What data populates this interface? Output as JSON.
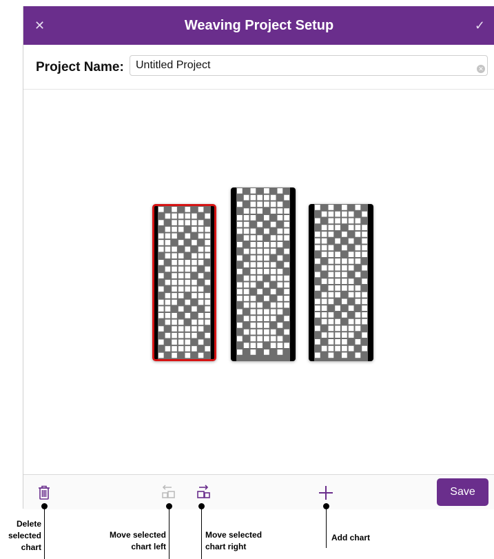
{
  "dialog": {
    "title": "Weaving Project Setup",
    "close_icon": "close-icon",
    "confirm_icon": "checkmark-icon",
    "accent_color": "#6a2e8c"
  },
  "project": {
    "label": "Project Name:",
    "value": "Untitled Project"
  },
  "charts": [
    {
      "name": "chart-1",
      "selected": true
    },
    {
      "name": "chart-2",
      "selected": false
    },
    {
      "name": "chart-3",
      "selected": false
    }
  ],
  "toolbar": {
    "delete_icon": "trash-icon",
    "move_left_icon": "move-left-icon",
    "move_right_icon": "move-right-icon",
    "add_icon": "plus-icon",
    "save_label": "Save"
  },
  "annotations": {
    "delete": [
      "Delete",
      "selected",
      "chart"
    ],
    "move_left": [
      "Move selected",
      "chart left"
    ],
    "move_right": [
      "Move selected",
      "chart right"
    ],
    "add": [
      "Add chart"
    ]
  }
}
